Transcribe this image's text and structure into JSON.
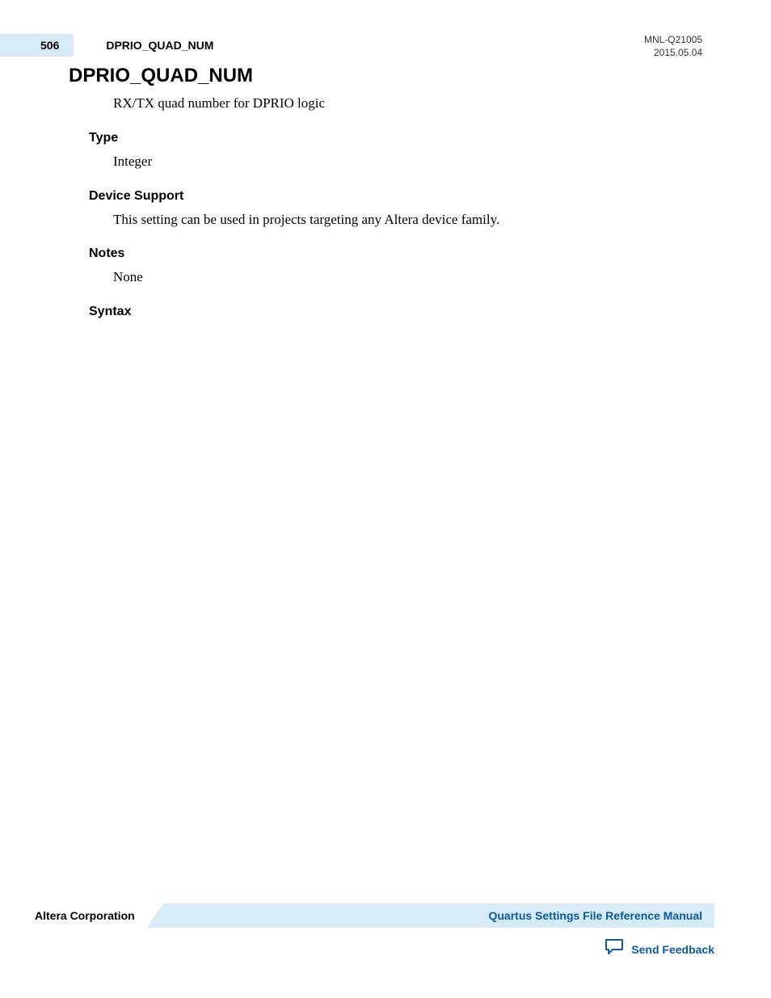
{
  "header": {
    "page_number": "506",
    "topic_label": "DPRIO_QUAD_NUM",
    "doc_id": "MNL-Q21005",
    "date": "2015.05.04"
  },
  "main": {
    "title": "DPRIO_QUAD_NUM",
    "description": "RX/TX quad number for DPRIO logic",
    "sections": {
      "type": {
        "heading": "Type",
        "body": "Integer"
      },
      "device_support": {
        "heading": "Device Support",
        "body": "This setting can be used in projects targeting any Altera device family."
      },
      "notes": {
        "heading": "Notes",
        "body": "None"
      },
      "syntax": {
        "heading": "Syntax",
        "body": ""
      }
    }
  },
  "footer": {
    "company": "Altera Corporation",
    "manual_link": "Quartus Settings File Reference Manual",
    "feedback_label": "Send Feedback"
  }
}
